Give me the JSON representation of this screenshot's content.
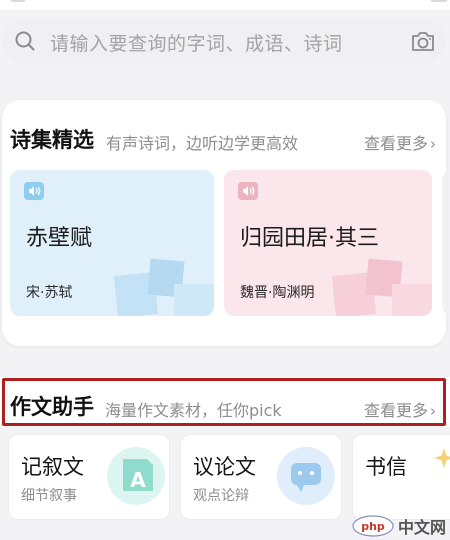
{
  "search": {
    "placeholder": "请输入要查询的字词、成语、诗词",
    "icon": "search-icon",
    "camera_icon": "camera-icon"
  },
  "poetry": {
    "title": "诗集精选",
    "subtitle": "有声诗词，边听边学更高效",
    "more_label": "查看更多",
    "cards": [
      {
        "title": "赤壁赋",
        "author": "宋·苏轼",
        "bg": "#dff0fb",
        "accent": "#7cc2ea"
      },
      {
        "title": "归园田居·其三",
        "author": "魏晋·陶渊明",
        "bg": "#fbe6ec",
        "accent": "#eaa7b6"
      }
    ]
  },
  "essay": {
    "title": "作文助手",
    "subtitle": "海量作文素材，任你pick",
    "more_label": "查看更多",
    "cards": [
      {
        "title": "记叙文",
        "subtitle": "细节叙事",
        "icon": "letter-a-icon"
      },
      {
        "title": "议论文",
        "subtitle": "观点论辩",
        "icon": "speech-bubble-icon"
      },
      {
        "title": "书信",
        "subtitle": "",
        "icon": "sparkle-icon"
      }
    ]
  },
  "watermark": {
    "text": "中文网",
    "logo_text": "php"
  },
  "colors": {
    "highlight": "#b11e1e",
    "muted": "#8d8d92"
  }
}
